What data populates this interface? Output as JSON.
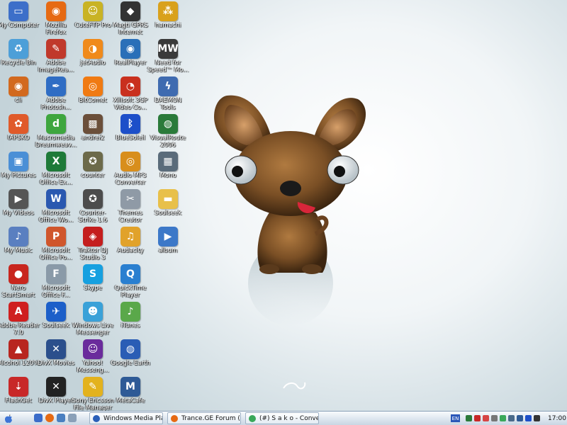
{
  "desktop": {
    "icons": [
      {
        "label": "My Computer",
        "icon": "computer-icon",
        "color": "#3d6fc9",
        "glyph": "▭"
      },
      {
        "label": "Recycle Bin",
        "icon": "recycle-bin-icon",
        "color": "#4d9fd8",
        "glyph": "♻"
      },
      {
        "label": "cli",
        "icon": "cli-icon",
        "color": "#d2691e",
        "glyph": "◉"
      },
      {
        "label": "IAPSKO",
        "icon": "msn-butterfly-icon",
        "color": "#e05a2a",
        "glyph": "✿"
      },
      {
        "label": "My Pictures",
        "icon": "pictures-folder-icon",
        "color": "#4a8fd6",
        "glyph": "▣"
      },
      {
        "label": "My Videos",
        "icon": "videos-folder-icon",
        "color": "#555",
        "glyph": "▶"
      },
      {
        "label": "My Music",
        "icon": "music-folder-icon",
        "color": "#5a7fc0",
        "glyph": "♪"
      },
      {
        "label": "Nero StartSmart",
        "icon": "nero-icon",
        "color": "#c8261e",
        "glyph": "●"
      },
      {
        "label": "Adobe Reader 7.0",
        "icon": "adobe-reader-icon",
        "color": "#cf1f1f",
        "glyph": "A"
      },
      {
        "label": "Alcohol 120%",
        "icon": "alcohol-icon",
        "color": "#b8251f",
        "glyph": "▲"
      },
      {
        "label": "FlashGet",
        "icon": "flashget-icon",
        "color": "#c82828",
        "glyph": "⇣"
      },
      {
        "label": "Mozilla Firefox",
        "icon": "firefox-icon",
        "color": "#e66a13",
        "glyph": "◉"
      },
      {
        "label": "Adobe ImageRea...",
        "icon": "imageready-icon",
        "color": "#c0392b",
        "glyph": "✎"
      },
      {
        "label": "Adobe Photosh...",
        "icon": "photoshop-icon",
        "color": "#2f6dc4",
        "glyph": "✒"
      },
      {
        "label": "Macromedia Dreamweav...",
        "icon": "dreamweaver-icon",
        "color": "#3ea63e",
        "glyph": "d"
      },
      {
        "label": "Microsoft Office Ex...",
        "icon": "excel-icon",
        "color": "#1e7a38",
        "glyph": "X"
      },
      {
        "label": "Microsoft Office Wo...",
        "icon": "word-icon",
        "color": "#2a58b0",
        "glyph": "W"
      },
      {
        "label": "Microsoft Office Po...",
        "icon": "powerpoint-icon",
        "color": "#d0562c",
        "glyph": "P"
      },
      {
        "label": "Microsoft Office F...",
        "icon": "frontpage-icon",
        "color": "#8a9aa8",
        "glyph": "F"
      },
      {
        "label": "Soulseek",
        "icon": "soulseek-bird-icon",
        "color": "#1c5fc9",
        "glyph": "✈"
      },
      {
        "label": "DivX Movies",
        "icon": "divx-movies-icon",
        "color": "#2b4f8c",
        "glyph": "✕"
      },
      {
        "label": "DivX Player",
        "icon": "divx-player-icon",
        "color": "#222",
        "glyph": "✕"
      },
      {
        "label": "CuteFTP Pro",
        "icon": "cuteftp-icon",
        "color": "#c9b324",
        "glyph": "☺"
      },
      {
        "label": "jetAudio",
        "icon": "jetaudio-icon",
        "color": "#f08a1b",
        "glyph": "◑"
      },
      {
        "label": "BitComet",
        "icon": "bitcomet-icon",
        "color": "#f07a12",
        "glyph": "◎"
      },
      {
        "label": "andrei2",
        "icon": "andrei-photo-icon",
        "color": "#6b4f3a",
        "glyph": "▩"
      },
      {
        "label": "counter",
        "icon": "counter-strike-icon",
        "color": "#6c6a4a",
        "glyph": "✪"
      },
      {
        "label": "Counter-Strike 1.6",
        "icon": "counter-strike-16-icon",
        "color": "#4c4c4c",
        "glyph": "✪"
      },
      {
        "label": "Traktor DJ Studio 3",
        "icon": "traktor-icon",
        "color": "#c41e1e",
        "glyph": "◈"
      },
      {
        "label": "Skype",
        "icon": "skype-icon",
        "color": "#16a0e0",
        "glyph": "S"
      },
      {
        "label": "Windows Live Messenger",
        "icon": "messenger-icon",
        "color": "#3aa1d8",
        "glyph": "☻"
      },
      {
        "label": "Yahoo! Messeng...",
        "icon": "yahoo-messenger-icon",
        "color": "#6a2b9c",
        "glyph": "☺"
      },
      {
        "label": "Sony Ericsson File Manager",
        "icon": "file-manager-icon",
        "color": "#e3b21e",
        "glyph": "✎"
      },
      {
        "label": "Magti GPRS Internet",
        "icon": "magti-icon",
        "color": "#333",
        "glyph": "◆"
      },
      {
        "label": "RealPlayer",
        "icon": "realplayer-icon",
        "color": "#2a6fb8",
        "glyph": "◉"
      },
      {
        "label": "Xilisoft 3GP Video Co...",
        "icon": "xilisoft-icon",
        "color": "#c9301e",
        "glyph": "◔"
      },
      {
        "label": "BlueSoleil",
        "icon": "bluetooth-icon",
        "color": "#1d4fc9",
        "glyph": "ᛒ"
      },
      {
        "label": "Audio MP3 Converter",
        "icon": "mp3-converter-icon",
        "color": "#d88e1c",
        "glyph": "◎"
      },
      {
        "label": "Themes Creator",
        "icon": "themes-creator-icon",
        "color": "#8f9aa6",
        "glyph": "✂"
      },
      {
        "label": "Audacity",
        "icon": "audacity-icon",
        "color": "#e1a22a",
        "glyph": "♫"
      },
      {
        "label": "QuickTime Player",
        "icon": "quicktime-icon",
        "color": "#2a7fd0",
        "glyph": "Q"
      },
      {
        "label": "iTunes",
        "icon": "itunes-icon",
        "color": "#5aa84a",
        "glyph": "♪"
      },
      {
        "label": "Google Earth",
        "icon": "google-earth-icon",
        "color": "#2a5db5",
        "glyph": "◍"
      },
      {
        "label": "MetaCafe",
        "icon": "metacafe-icon",
        "color": "#2e5a96",
        "glyph": "M"
      },
      {
        "label": "hamachi",
        "icon": "hamachi-icon",
        "color": "#d9a11c",
        "glyph": "⁂"
      },
      {
        "label": "Need for Speed™ Mo...",
        "icon": "nfs-icon",
        "color": "#3a3a3a",
        "glyph": "MW"
      },
      {
        "label": "DAEMON Tools",
        "icon": "daemon-tools-icon",
        "color": "#3f6bb0",
        "glyph": "ϟ"
      },
      {
        "label": "VisualRoute 2006",
        "icon": "visualroute-icon",
        "color": "#2a7a3a",
        "glyph": "◍"
      },
      {
        "label": "Mono",
        "icon": "mono-icon",
        "color": "#5a6b7a",
        "glyph": "▦"
      },
      {
        "label": "Soulseek",
        "icon": "folder-icon",
        "color": "#e8c04a",
        "glyph": "▬"
      },
      {
        "label": "album",
        "icon": "media-file-icon",
        "color": "#3c78c8",
        "glyph": "▶"
      }
    ]
  },
  "taskbar": {
    "tasks": [
      {
        "label": "Windows Media Player",
        "color": "#2a5fb8"
      },
      {
        "label": "Trance.GE Forum (Po...",
        "color": "#e66a13"
      },
      {
        "label": "(#) S a k o - Conversat...",
        "color": "#3aa85a"
      }
    ],
    "tray": {
      "language": "EN",
      "clock": "17:00"
    }
  }
}
